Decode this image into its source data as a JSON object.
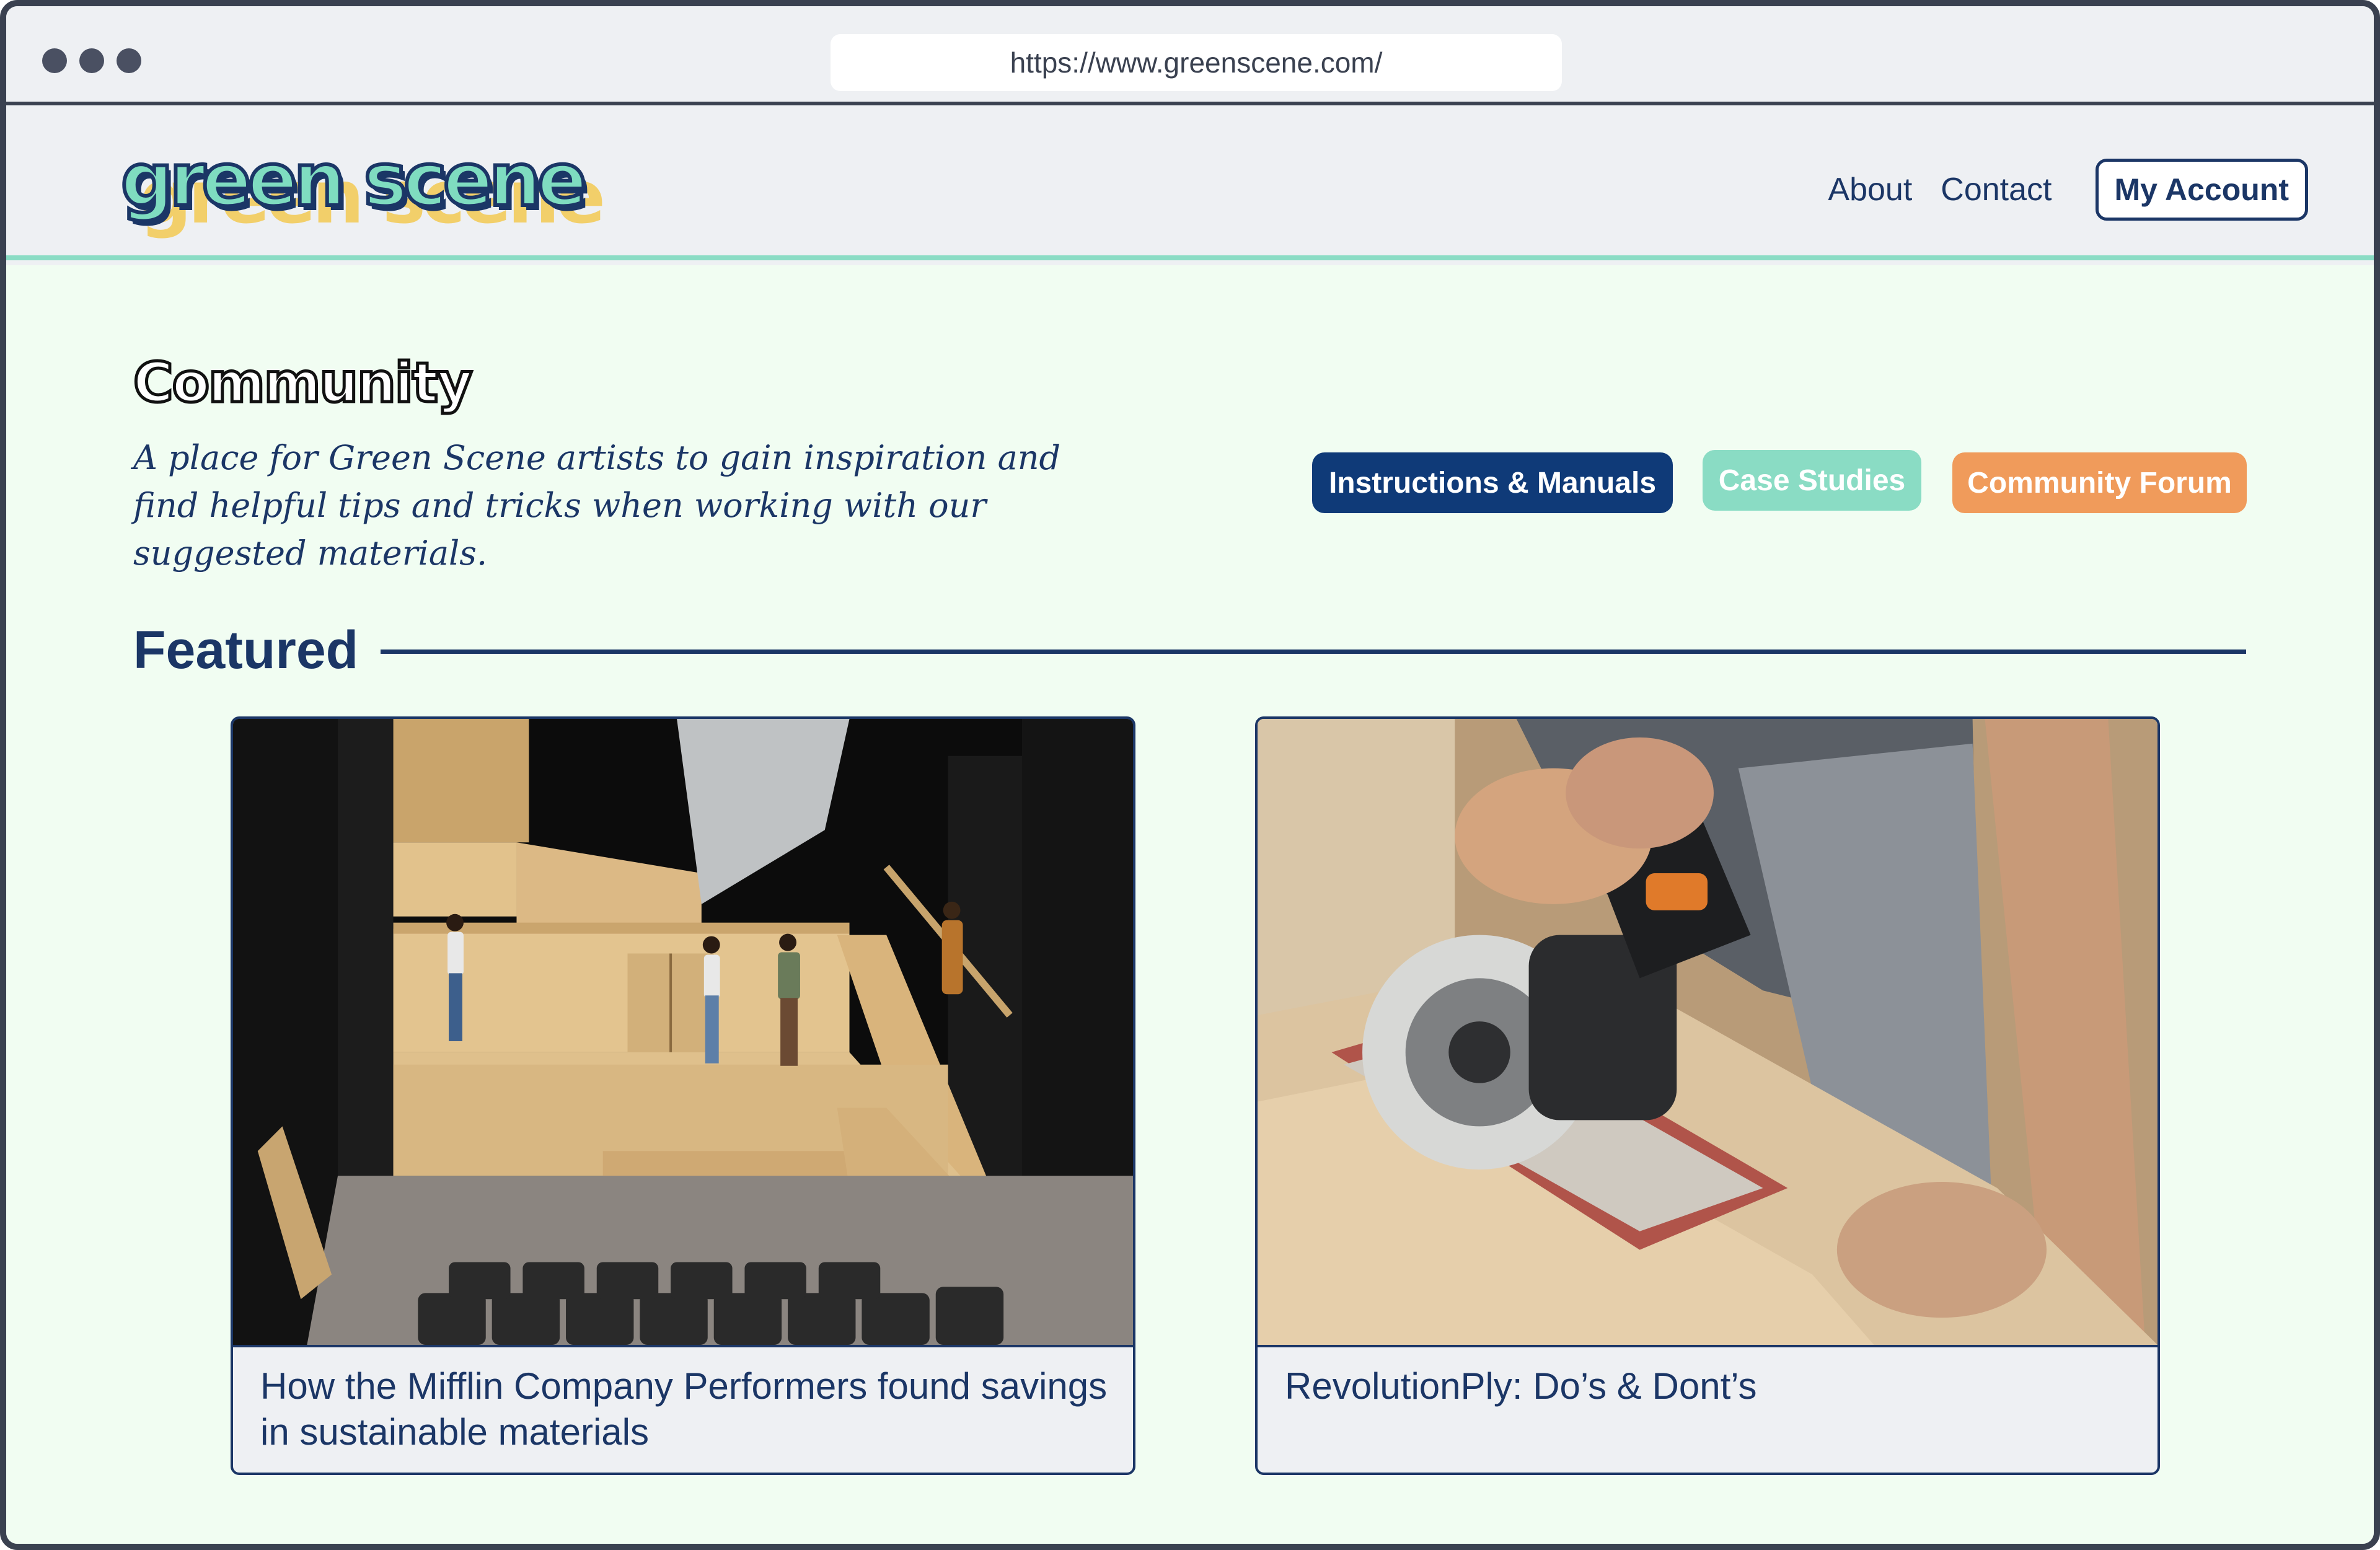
{
  "browser": {
    "url": "https://www.greenscene.com/"
  },
  "header": {
    "logo_text": "green scene",
    "nav": {
      "about": "About",
      "contact": "Contact",
      "account": "My Account"
    }
  },
  "main": {
    "title": "Community",
    "intro": "A place for Green Scene artists to gain inspiration and find helpful tips and tricks when working with our suggested materials.",
    "buttons": {
      "instructions": "Instructions & Manuals",
      "case_studies": "Case Studies",
      "forum": "Community Forum"
    },
    "featured": {
      "heading": "Featured",
      "cards": [
        {
          "caption": "How the Mifflin Company Performers found savings in sustainable materials",
          "image": "theater-stage-photo"
        },
        {
          "caption": "RevolutionPly: Do’s & Dont’s",
          "image": "circular-saw-photo"
        }
      ]
    }
  },
  "colors": {
    "navy": "#1b3666",
    "button_navy": "#0f3a78",
    "mint": "#8adcc4",
    "orange": "#f09b5b",
    "page_bg": "#f1fdf2",
    "logo_yellow": "#f2cf6a"
  }
}
